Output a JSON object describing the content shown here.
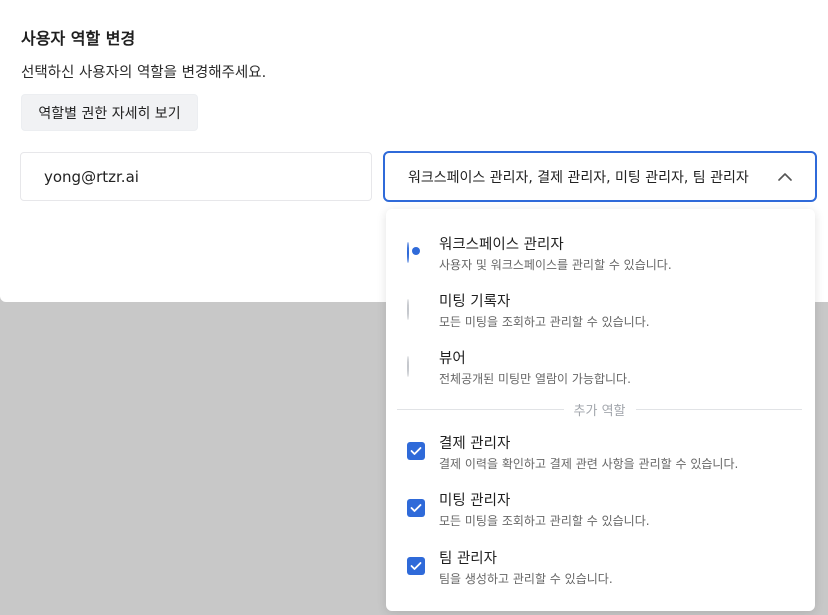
{
  "dialog": {
    "title": "사용자 역할 변경",
    "subtitle": "선택하신 사용자의 역할을 변경해주세요.",
    "detail_button": "역할별 권한 자세히 보기"
  },
  "user": {
    "email": "yong@rtzr.ai"
  },
  "role_select": {
    "value": "워크스페이스 관리자, 결제 관리자, 미팅 관리자, 팀 관리자",
    "expanded": true,
    "chevron_icon": "chevron-up-icon"
  },
  "dropdown": {
    "primary_roles": [
      {
        "label": "워크스페이스 관리자",
        "desc": "사용자 및 워크스페이스를 관리할 수 있습니다.",
        "selected": true
      },
      {
        "label": "미팅 기록자",
        "desc": "모든 미팅을 조회하고 관리할 수 있습니다.",
        "selected": false
      },
      {
        "label": "뷰어",
        "desc": "전체공개된 미팅만 열람이 가능합니다.",
        "selected": false
      }
    ],
    "extra_section_label": "추가 역할",
    "extra_roles": [
      {
        "label": "결제 관리자",
        "desc": "결제 이력을 확인하고 결제 관련 사항을 관리할 수 있습니다.",
        "checked": true
      },
      {
        "label": "미팅 관리자",
        "desc": "모든 미팅을 조회하고 관리할 수 있습니다.",
        "checked": true
      },
      {
        "label": "팀 관리자",
        "desc": "팀을 생성하고 관리할 수 있습니다.",
        "checked": true
      }
    ]
  },
  "colors": {
    "accent": "#2f6ad9",
    "overlay": "#c8c8c8"
  }
}
